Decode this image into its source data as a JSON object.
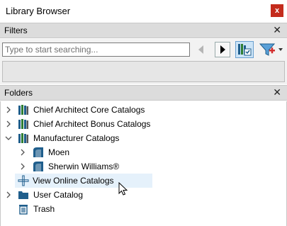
{
  "window": {
    "title": "Library Browser",
    "close_glyph": "x"
  },
  "filters": {
    "header_label": "Filters",
    "close_glyph": "✕",
    "search_placeholder": "Type to start searching...",
    "icons": [
      "back-arrow-icon",
      "forward-arrow-icon",
      "library-view-icon",
      "filter-add-icon",
      "dropdown-caret-icon"
    ]
  },
  "folders": {
    "header_label": "Folders",
    "close_glyph": "✕",
    "items": [
      {
        "label": "Chief Architect Core Catalogs",
        "expander": "collapsed",
        "icon": "book-stack-icon"
      },
      {
        "label": "Chief Architect Bonus Catalogs",
        "expander": "collapsed",
        "icon": "book-stack-icon"
      },
      {
        "label": "Manufacturer Catalogs",
        "expander": "expanded",
        "icon": "book-stack-icon"
      },
      {
        "label": "Moen",
        "expander": "collapsed",
        "icon": "manufacturer-icon"
      },
      {
        "label": "Sherwin Williams®",
        "expander": "collapsed",
        "icon": "manufacturer-icon"
      },
      {
        "label": "View Online Catalogs",
        "expander": "none",
        "icon": "add-plus-icon"
      },
      {
        "label": "User Catalog",
        "expander": "collapsed",
        "icon": "folder-icon"
      },
      {
        "label": "Trash",
        "expander": "none",
        "icon": "trash-icon"
      }
    ]
  },
  "colors": {
    "close_red": "#c42b1c",
    "hover_row": "#e5f1fb",
    "manufacturer_blue": "#1f5e8c",
    "folder_blue": "#1f5e8c"
  }
}
